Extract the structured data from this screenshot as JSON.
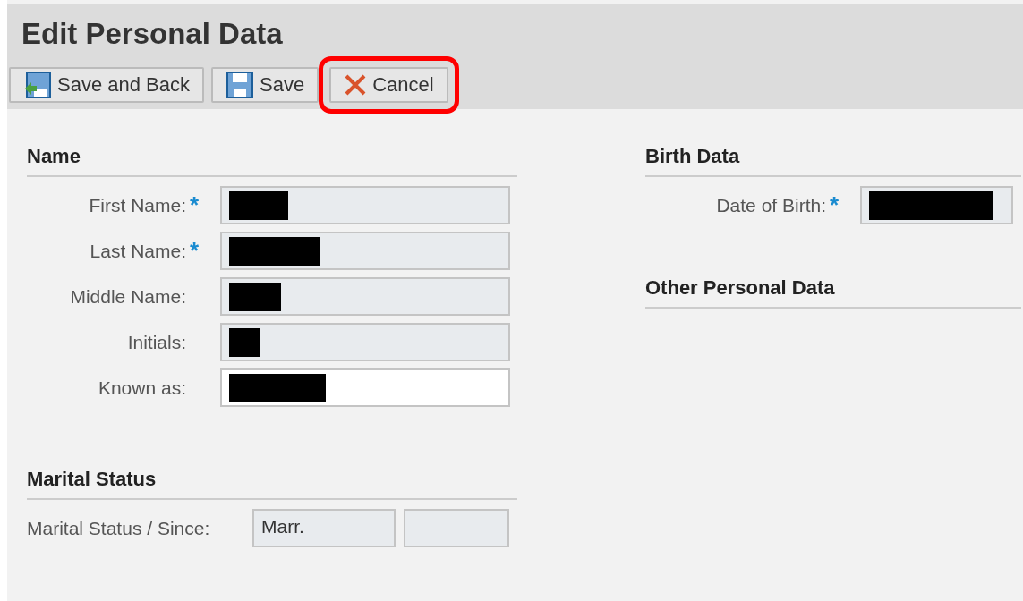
{
  "title": "Edit Personal Data",
  "toolbar": [
    {
      "label": "Save and Back",
      "kind": "save-back",
      "highlighted": false
    },
    {
      "label": "Save",
      "kind": "save",
      "highlighted": false
    },
    {
      "label": "Cancel",
      "kind": "cancel",
      "highlighted": true
    }
  ],
  "left_sections": [
    {
      "heading": "Name",
      "fields": [
        {
          "label": "First Name:",
          "required_mark": "*",
          "readonly": true,
          "redacted": true
        },
        {
          "label": "Last Name:",
          "required_mark": "*",
          "readonly": true,
          "redacted": true
        },
        {
          "label": "Middle Name:",
          "readonly": true,
          "redacted": true
        },
        {
          "label": "Initials:",
          "readonly": true,
          "redacted": true
        },
        {
          "label": "Known as:",
          "readonly": false,
          "redacted": true
        }
      ]
    },
    {
      "heading": "Marital Status",
      "label": "Marital Status / Since:",
      "inputs": [
        {
          "value": "Marr.",
          "readonly": true
        },
        {
          "readonly": true
        }
      ]
    }
  ],
  "right_sections": [
    {
      "heading": "Birth Data",
      "fields": [
        {
          "label": "Date of Birth:",
          "required_mark": "*",
          "readonly": true,
          "redacted": true
        }
      ]
    },
    {
      "heading": "Other Personal Data"
    }
  ]
}
